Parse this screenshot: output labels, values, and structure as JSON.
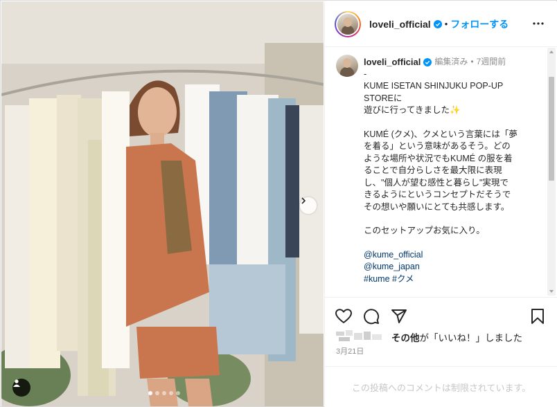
{
  "post": {
    "username": "loveli_official",
    "follow_label": "フォローする",
    "separator": "•"
  },
  "caption": {
    "username": "loveli_official",
    "edited": "編集済み",
    "dot": "•",
    "time": "7週間前",
    "lines": [
      "-",
      "KUME ISETAN SHINJUKU POP-UP",
      "STOREに",
      "遊びに行ってきました✨",
      "",
      "KUMÉ (クメ)、クメという言葉には「夢",
      "を着る」という意味があるそう。どの",
      "ような場所や状況でもKUMÉ の服を着",
      "ることで自分らしさを最大限に表現",
      "し、\"個人が望む感性と暮らし\"実現で",
      "きるようにというコンセプトだそうで",
      "その想いや願いにとても共感します。",
      "",
      "このセットアップお気に入り。",
      ""
    ],
    "tags": [
      "@kume_official",
      "@kume_japan"
    ],
    "hashtags": [
      "#kume",
      "#クメ"
    ]
  },
  "likes": {
    "others": "その他",
    "suffix": "が「いいね！」しました"
  },
  "date": "3月21日",
  "comments_disabled": "この投稿へのコメントは制限されています。",
  "carousel": {
    "count": 5,
    "active_index": 1
  },
  "colors": {
    "accent": "#0095f6",
    "link": "#00376b",
    "text": "#262626",
    "muted": "#8e8e8e",
    "verified": "#0095f6"
  },
  "icons": [
    "more-icon",
    "heart-icon",
    "comment-icon",
    "share-icon",
    "bookmark-icon",
    "chevron-right-icon",
    "user-tag-icon",
    "verified-icon"
  ]
}
